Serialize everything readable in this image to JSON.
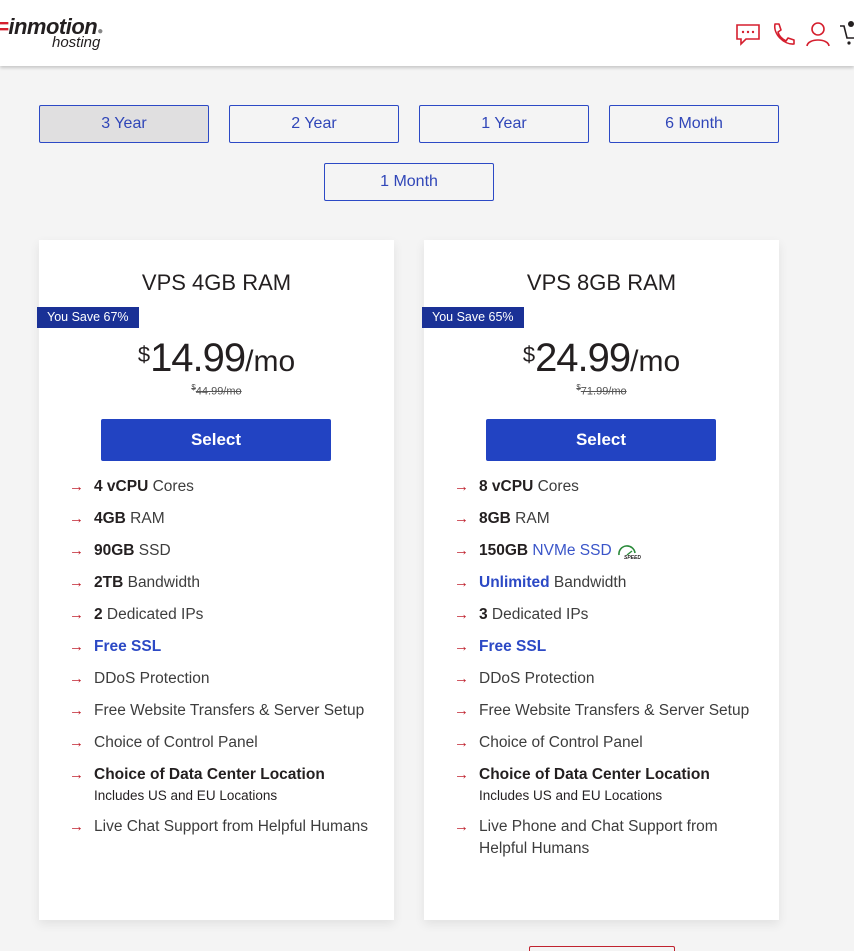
{
  "header": {
    "logo_main": "inmotion",
    "logo_sub": "hosting",
    "icons": [
      "chat-icon",
      "phone-icon",
      "user-icon",
      "cart-icon"
    ]
  },
  "terms": {
    "options": [
      "3 Year",
      "2 Year",
      "1 Year",
      "6 Month",
      "1 Month"
    ],
    "selected": "3 Year"
  },
  "plans": [
    {
      "title": "VPS 4GB RAM",
      "save_badge": "You Save 67%",
      "currency": "$",
      "price": "14.99",
      "period": "/mo",
      "old_price": "44.99/mo",
      "old_currency": "$",
      "select_label": "Select",
      "features": [
        {
          "bold": "4 vCPU",
          "text": " Cores"
        },
        {
          "bold": "4GB",
          "text": " RAM"
        },
        {
          "bold": "90GB",
          "text": " SSD"
        },
        {
          "bold": "2TB",
          "text": " Bandwidth"
        },
        {
          "bold": "2",
          "text": " Dedicated IPs"
        },
        {
          "blue": "Free SSL"
        },
        {
          "text": "DDoS Protection"
        },
        {
          "text": "Free Website Transfers & Server Setup"
        },
        {
          "text": "Choice of Control Panel"
        },
        {
          "bold": "Choice of Data Center Location",
          "sub": "Includes US and EU Locations"
        },
        {
          "text": "Live Chat Support from Helpful Humans"
        }
      ]
    },
    {
      "title": "VPS 8GB RAM",
      "save_badge": "You Save 65%",
      "currency": "$",
      "price": "24.99",
      "period": "/mo",
      "old_price": "71.99/mo",
      "old_currency": "$",
      "select_label": "Select",
      "features": [
        {
          "bold": "8 vCPU",
          "text": " Cores"
        },
        {
          "bold": "8GB",
          "text": " RAM"
        },
        {
          "bold": "150GB",
          "blue_plain": " NVMe SSD",
          "icon": "speed-icon",
          "icon_text": "SPEED"
        },
        {
          "blue": "Unlimited",
          "text": " Bandwidth"
        },
        {
          "bold": "3",
          "text": " Dedicated IPs"
        },
        {
          "blue": "Free SSL"
        },
        {
          "text": "DDoS Protection"
        },
        {
          "text": "Free Website Transfers & Server Setup"
        },
        {
          "text": "Choice of Control Panel"
        },
        {
          "bold": "Choice of Data Center Location",
          "sub": "Includes US and EU Locations"
        },
        {
          "text": "Live Phone and Chat Support from Helpful Humans"
        }
      ]
    }
  ],
  "colors": {
    "accent_blue": "#2243c2",
    "badge_blue": "#1a3196",
    "arrow_red": "#c0232f"
  }
}
